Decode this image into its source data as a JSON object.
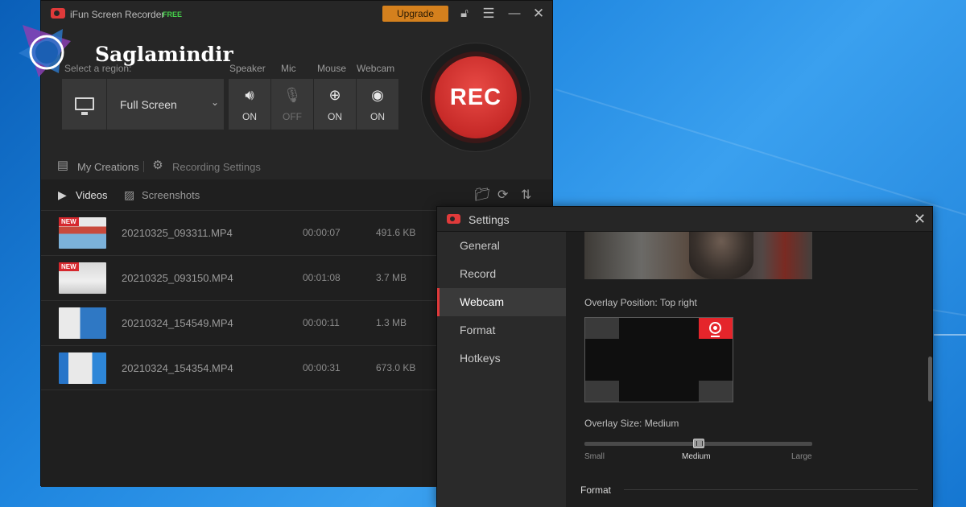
{
  "watermark": {
    "text": "Saglamindir"
  },
  "main_window": {
    "app_name": "iFun Screen Recorder",
    "edition_badge": "FREE",
    "upgrade_label": "Upgrade",
    "region_label": "Select a region:",
    "region_value": "Full Screen",
    "controls": [
      {
        "label": "Speaker",
        "state": "ON",
        "icon": "speaker-icon"
      },
      {
        "label": "Mic",
        "state": "OFF",
        "icon": "mic-icon"
      },
      {
        "label": "Mouse",
        "state": "ON",
        "icon": "mouse-icon"
      },
      {
        "label": "Webcam",
        "state": "ON",
        "icon": "webcam-icon"
      }
    ],
    "rec_label": "REC",
    "links": {
      "my_creations": "My Creations",
      "recording_settings": "Recording Settings"
    },
    "tabs": {
      "videos": "Videos",
      "screenshots": "Screenshots"
    },
    "new_badge": "NEW",
    "files": [
      {
        "name": "20210325_093311.MP4",
        "duration": "00:00:07",
        "size": "491.6 KB",
        "is_new": true
      },
      {
        "name": "20210325_093150.MP4",
        "duration": "00:01:08",
        "size": "3.7 MB",
        "is_new": true
      },
      {
        "name": "20210324_154549.MP4",
        "duration": "00:00:11",
        "size": "1.3 MB",
        "is_new": false
      },
      {
        "name": "20210324_154354.MP4",
        "duration": "00:00:31",
        "size": "673.0 KB",
        "is_new": false
      }
    ]
  },
  "settings_window": {
    "title": "Settings",
    "nav": [
      "General",
      "Record",
      "Webcam",
      "Format",
      "Hotkeys"
    ],
    "active_nav": "Webcam",
    "overlay_position_label": "Overlay Position: Top right",
    "overlay_size_label": "Overlay Size: Medium",
    "slider_labels": [
      "Small",
      "Medium",
      "Large"
    ],
    "slider_selected": "Medium",
    "format_heading": "Format"
  },
  "colors": {
    "accent_red": "#e0393a",
    "upgrade_orange": "#d4801d",
    "free_green": "#45d04a"
  }
}
